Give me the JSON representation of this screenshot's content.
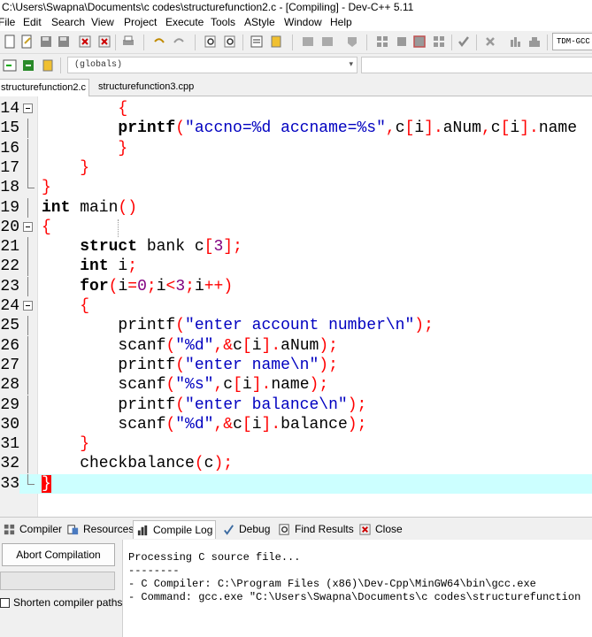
{
  "window": {
    "title": "C:\\Users\\Swapna\\Documents\\c codes\\structurefunction2.c - [Compiling] - Dev-C++ 5.11"
  },
  "menu": [
    "File",
    "Edit",
    "Search",
    "View",
    "Project",
    "Execute",
    "Tools",
    "AStyle",
    "Window",
    "Help"
  ],
  "toolbar": {
    "compiler_select": "TDM-GCC",
    "scope_select": "(globals)",
    "scope_arrow": "▾"
  },
  "file_tabs": [
    "structurefunction2.c",
    "structurefunction3.cpp"
  ],
  "editor": {
    "line_numbers": [
      "14",
      "15",
      "16",
      "17",
      "18",
      "19",
      "20",
      "21",
      "22",
      "23",
      "24",
      "25",
      "26",
      "27",
      "28",
      "29",
      "30",
      "31",
      "32",
      "33"
    ],
    "lines": [
      [
        [
          "t",
          "        "
        ],
        [
          "p",
          "{"
        ]
      ],
      [
        [
          "t",
          "        "
        ],
        [
          "k",
          "printf"
        ],
        [
          "p",
          "("
        ],
        [
          "s",
          "\"accno=%d accname=%s\""
        ],
        [
          "p",
          ","
        ],
        [
          "t",
          "c"
        ],
        [
          "p",
          "["
        ],
        [
          "t",
          "i"
        ],
        [
          "p",
          "]."
        ],
        [
          "t",
          "aNum"
        ],
        [
          "p",
          ","
        ],
        [
          "t",
          "c"
        ],
        [
          "p",
          "["
        ],
        [
          "t",
          "i"
        ],
        [
          "p",
          "]."
        ],
        [
          "t",
          "name"
        ]
      ],
      [
        [
          "t",
          "        "
        ],
        [
          "p",
          "}"
        ]
      ],
      [
        [
          "t",
          "    "
        ],
        [
          "p",
          "}"
        ]
      ],
      [
        [
          "p",
          "}"
        ]
      ],
      [
        [
          "k",
          "int"
        ],
        [
          "t",
          " main"
        ],
        [
          "p",
          "()"
        ]
      ],
      [
        [
          "p",
          "{"
        ]
      ],
      [
        [
          "t",
          "    "
        ],
        [
          "k",
          "struct"
        ],
        [
          "t",
          " bank c"
        ],
        [
          "p",
          "["
        ],
        [
          "n",
          "3"
        ],
        [
          "p",
          "];"
        ]
      ],
      [
        [
          "t",
          "    "
        ],
        [
          "k",
          "int"
        ],
        [
          "t",
          " i"
        ],
        [
          "p",
          ";"
        ]
      ],
      [
        [
          "t",
          "    "
        ],
        [
          "k",
          "for"
        ],
        [
          "p",
          "("
        ],
        [
          "t",
          "i"
        ],
        [
          "p",
          "="
        ],
        [
          "n",
          "0"
        ],
        [
          "p",
          ";"
        ],
        [
          "t",
          "i"
        ],
        [
          "p",
          "<"
        ],
        [
          "n",
          "3"
        ],
        [
          "p",
          ";"
        ],
        [
          "t",
          "i"
        ],
        [
          "p",
          "++)"
        ]
      ],
      [
        [
          "t",
          "    "
        ],
        [
          "p",
          "{"
        ]
      ],
      [
        [
          "t",
          "        printf"
        ],
        [
          "p",
          "("
        ],
        [
          "s",
          "\"enter account number\\n\""
        ],
        [
          "p",
          ");"
        ]
      ],
      [
        [
          "t",
          "        scanf"
        ],
        [
          "p",
          "("
        ],
        [
          "s",
          "\"%d\""
        ],
        [
          "p",
          ","
        ],
        [
          "p",
          "&"
        ],
        [
          "t",
          "c"
        ],
        [
          "p",
          "["
        ],
        [
          "t",
          "i"
        ],
        [
          "p",
          "]."
        ],
        [
          "t",
          "aNum"
        ],
        [
          "p",
          ");"
        ]
      ],
      [
        [
          "t",
          "        printf"
        ],
        [
          "p",
          "("
        ],
        [
          "s",
          "\"enter name\\n\""
        ],
        [
          "p",
          ");"
        ]
      ],
      [
        [
          "t",
          "        scanf"
        ],
        [
          "p",
          "("
        ],
        [
          "s",
          "\"%s\""
        ],
        [
          "p",
          ","
        ],
        [
          "t",
          "c"
        ],
        [
          "p",
          "["
        ],
        [
          "t",
          "i"
        ],
        [
          "p",
          "]."
        ],
        [
          "t",
          "name"
        ],
        [
          "p",
          ");"
        ]
      ],
      [
        [
          "t",
          "        printf"
        ],
        [
          "p",
          "("
        ],
        [
          "s",
          "\"enter balance\\n\""
        ],
        [
          "p",
          ");"
        ]
      ],
      [
        [
          "t",
          "        scanf"
        ],
        [
          "p",
          "("
        ],
        [
          "s",
          "\"%d\""
        ],
        [
          "p",
          ","
        ],
        [
          "p",
          "&"
        ],
        [
          "t",
          "c"
        ],
        [
          "p",
          "["
        ],
        [
          "t",
          "i"
        ],
        [
          "p",
          "]."
        ],
        [
          "t",
          "balance"
        ],
        [
          "p",
          ");"
        ]
      ],
      [
        [
          "t",
          "    "
        ],
        [
          "p",
          "}"
        ]
      ],
      [
        [
          "t",
          "    checkbalance"
        ],
        [
          "p",
          "("
        ],
        [
          "t",
          "c"
        ],
        [
          "p",
          ");"
        ]
      ],
      [
        [
          "cursor",
          "}"
        ]
      ]
    ]
  },
  "bottom_tabs": [
    "Compiler",
    "Resources",
    "Compile Log",
    "Debug",
    "Find Results",
    "Close"
  ],
  "compile_log": {
    "abort_button": "Abort Compilation",
    "shorten_label": "Shorten compiler paths",
    "lines": [
      "Processing C source file...",
      "--------",
      "- C Compiler: C:\\Program Files (x86)\\Dev-Cpp\\MinGW64\\bin\\gcc.exe",
      "- Command: gcc.exe \"C:\\Users\\Swapna\\Documents\\c codes\\structurefunction"
    ]
  },
  "colors": {
    "keyword": "#000000",
    "string": "#0000c0",
    "punct": "#ff0000",
    "number": "#800080",
    "current_line": "#ccffff"
  }
}
